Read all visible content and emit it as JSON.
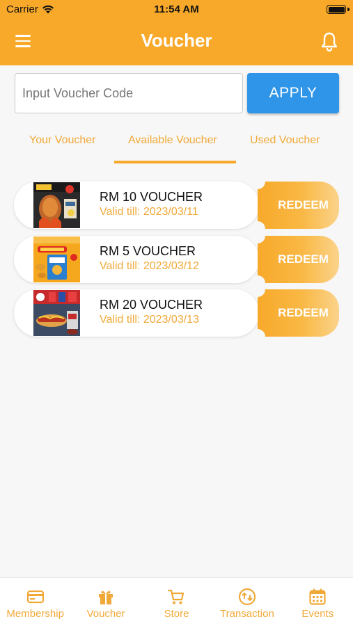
{
  "status_bar": {
    "carrier": "Carrier",
    "time": "11:54 AM"
  },
  "header": {
    "title": "Voucher",
    "menu_icon": "hamburger-menu-icon",
    "bell_icon": "bell-icon"
  },
  "voucher_code": {
    "placeholder": "Input Voucher Code",
    "value": "",
    "apply_label": "APPLY"
  },
  "tabs": [
    {
      "label": "Your Voucher",
      "active": false
    },
    {
      "label": "Available Voucher",
      "active": true
    },
    {
      "label": "Used Voucher",
      "active": false
    }
  ],
  "vouchers": [
    {
      "name": "RM 10 VOUCHER",
      "valid": "Valid till: 2023/03/11",
      "redeem_label": "REDEEM",
      "image": "roast-duck-promo"
    },
    {
      "name": "RM 5 VOUCHER",
      "valid": "Valid till: 2023/03/12",
      "redeem_label": "REDEEM",
      "image": "fish-nuggets-promo"
    },
    {
      "name": "RM 20 VOUCHER",
      "valid": "Valid till: 2023/03/13",
      "redeem_label": "REDEEM",
      "image": "hotdog-sausage-promo"
    }
  ],
  "bottom_nav": [
    {
      "label": "Membership",
      "icon": "membership-card-icon"
    },
    {
      "label": "Voucher",
      "icon": "gift-icon"
    },
    {
      "label": "Store",
      "icon": "cart-icon"
    },
    {
      "label": "Transaction",
      "icon": "transaction-icon"
    },
    {
      "label": "Events",
      "icon": "calendar-icon"
    }
  ],
  "colors": {
    "primary": "#f8a92a",
    "accent_text": "#f0a938",
    "apply_button": "#2f95e8",
    "background": "#f7f7f7"
  }
}
